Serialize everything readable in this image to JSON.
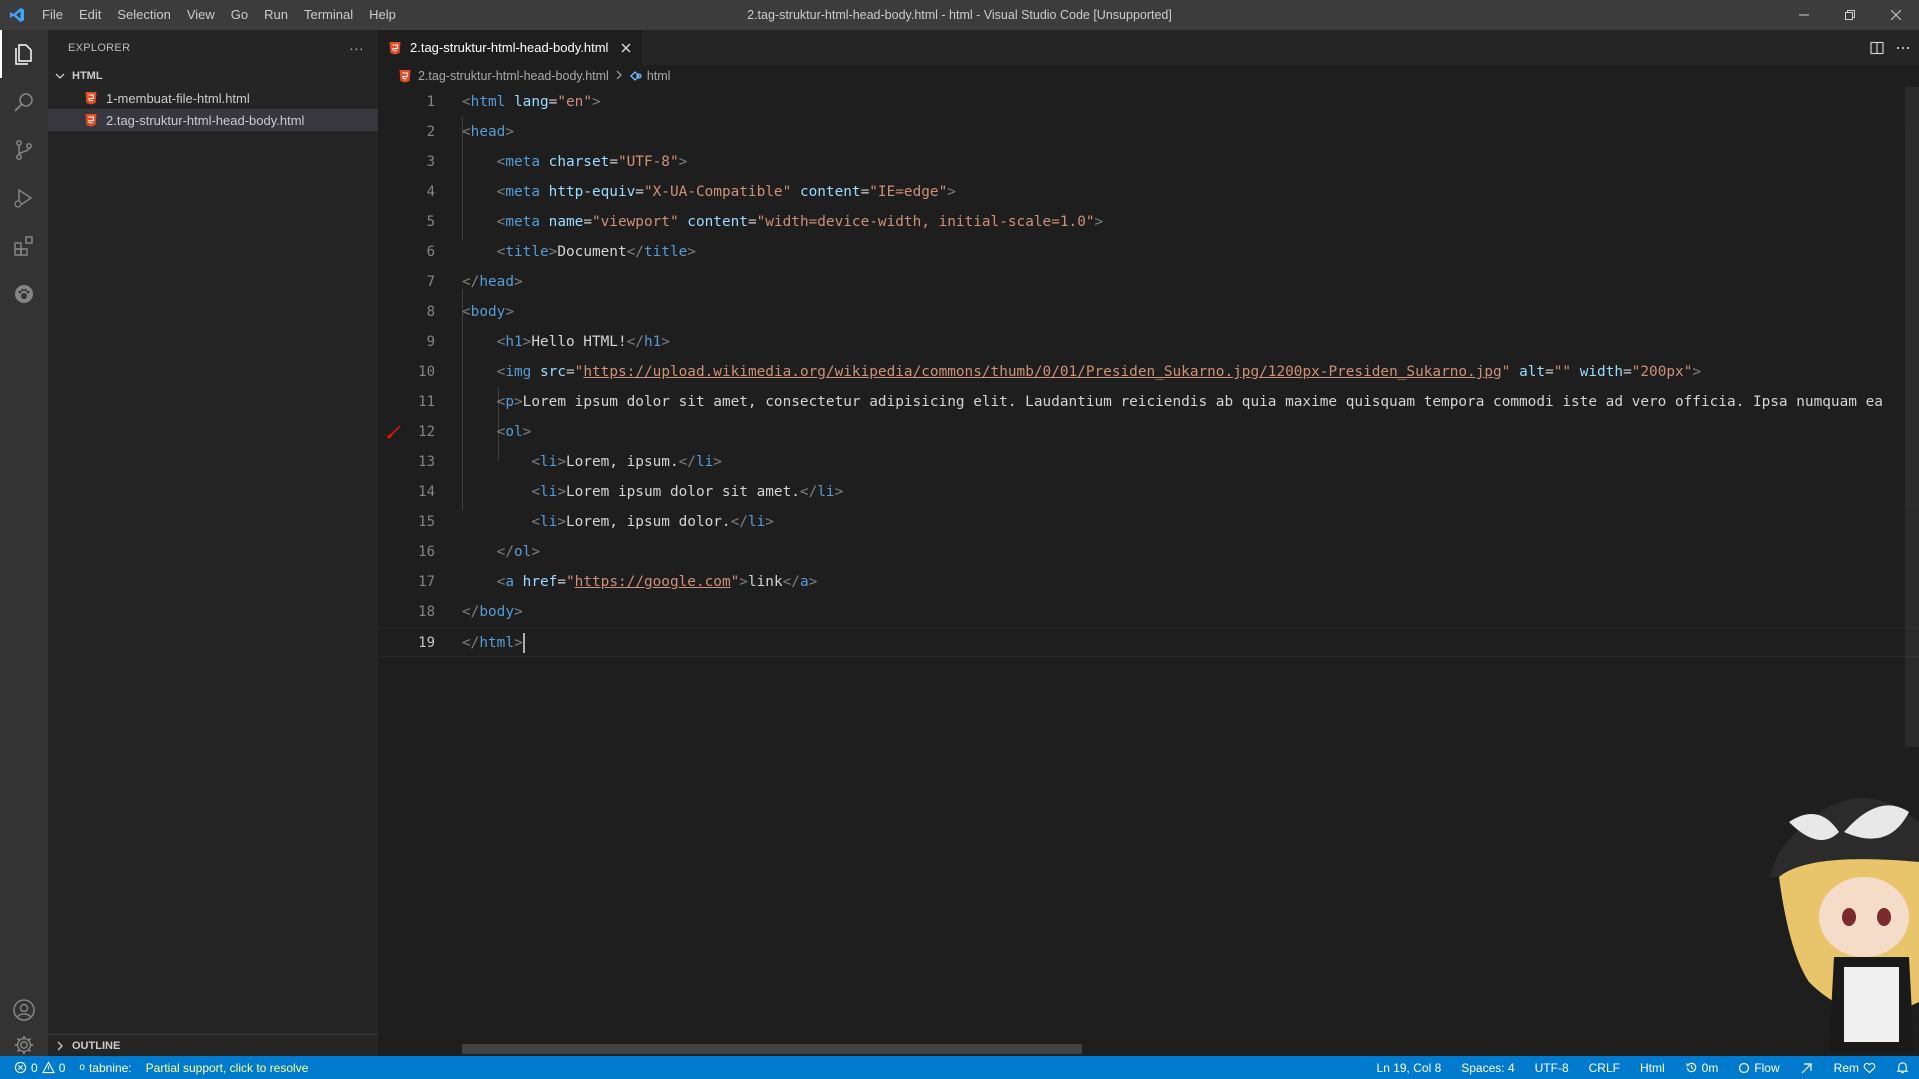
{
  "window": {
    "title": "2.tag-struktur-html-head-body.html - html - Visual Studio Code [Unsupported]"
  },
  "menu": [
    "File",
    "Edit",
    "Selection",
    "View",
    "Go",
    "Run",
    "Terminal",
    "Help"
  ],
  "sidebar": {
    "header": "EXPLORER",
    "more": "···",
    "folder": "HTML",
    "files": [
      {
        "name": "1-membuat-file-html.html"
      },
      {
        "name": "2.tag-struktur-html-head-body.html"
      }
    ],
    "outline": "OUTLINE"
  },
  "editor": {
    "tab_label": "2.tag-struktur-html-head-body.html",
    "breadcrumb": {
      "file": "2.tag-struktur-html-head-body.html",
      "symbol": "html"
    },
    "lines": [
      {
        "num": "1"
      },
      {
        "num": "2"
      },
      {
        "num": "3"
      },
      {
        "num": "4"
      },
      {
        "num": "5"
      },
      {
        "num": "6"
      },
      {
        "num": "7"
      },
      {
        "num": "8"
      },
      {
        "num": "9"
      },
      {
        "num": "10"
      },
      {
        "num": "11"
      },
      {
        "num": "12"
      },
      {
        "num": "13"
      },
      {
        "num": "14"
      },
      {
        "num": "15"
      },
      {
        "num": "16"
      },
      {
        "num": "17"
      },
      {
        "num": "18"
      },
      {
        "num": "19"
      }
    ],
    "code": {
      "l1": {
        "attr": "lang",
        "val": "\"en\""
      },
      "l3": {
        "attr": "charset",
        "val": "\"UTF-8\""
      },
      "l4": {
        "attr1": "http-equiv",
        "val1": "\"X-UA-Compatible\"",
        "attr2": "content",
        "val2": "\"IE=edge\""
      },
      "l5": {
        "attr1": "name",
        "val1": "\"viewport\"",
        "attr2": "content",
        "val2": "\"width=device-width, initial-scale=1.0\""
      },
      "l6": {
        "text": "Document"
      },
      "l9": {
        "text": "Hello HTML!"
      },
      "l10": {
        "attr1": "src",
        "url": "https://upload.wikimedia.org/wikipedia/commons/thumb/0/01/Presiden_Sukarno.jpg/1200px-Presiden_Sukarno.jpg",
        "attr2": "alt",
        "val2": "\"\"",
        "attr3": "width",
        "val3": "\"200px\""
      },
      "l11": {
        "text": "Lorem ipsum dolor sit amet, consectetur adipisicing elit. Laudantium reiciendis ab quia maxime quisquam tempora commodi iste ad vero officia. Ipsa numquam ea"
      },
      "l13": {
        "text": "Lorem, ipsum."
      },
      "l14": {
        "text": "Lorem ipsum dolor sit amet."
      },
      "l15": {
        "text": "Lorem, ipsum dolor."
      },
      "l17": {
        "attr": "href",
        "url": "https://google.com",
        "text": "link"
      }
    }
  },
  "statusbar": {
    "errors": "0",
    "warnings": "0",
    "tabnine": "tabnine:",
    "tabnine_warning": "Partial support, click to resolve",
    "position": "Ln 19, Col 8",
    "spaces": "Spaces: 4",
    "encoding": "UTF-8",
    "eol": "CRLF",
    "language": "Html",
    "timer": "0m",
    "flow": "Flow",
    "rem": "Rem"
  },
  "colors": {
    "accent": "#007acc",
    "tag": "#569cd6",
    "attr": "#9cdcfe",
    "string": "#ce9178"
  }
}
